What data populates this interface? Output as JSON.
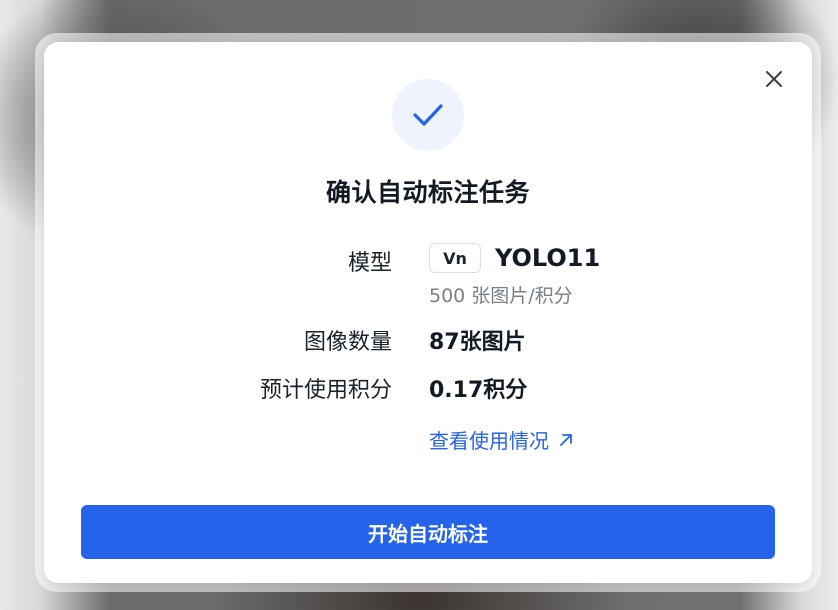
{
  "dialog": {
    "title": "确认自动标注任务",
    "close_icon": "close-icon",
    "success_icon": "check-icon",
    "accent_color": "#2563eb"
  },
  "details": {
    "model_label": "模型",
    "model_badge": "Vn",
    "model_name": "YOLO11",
    "model_rate": "500 张图片/积分",
    "image_count_label": "图像数量",
    "image_count_value": "87张图片",
    "credits_label": "预计使用积分",
    "credits_value": "0.17积分",
    "usage_link": "查看使用情况",
    "usage_link_icon": "arrow-up-right-icon"
  },
  "actions": {
    "start_label": "开始自动标注"
  }
}
